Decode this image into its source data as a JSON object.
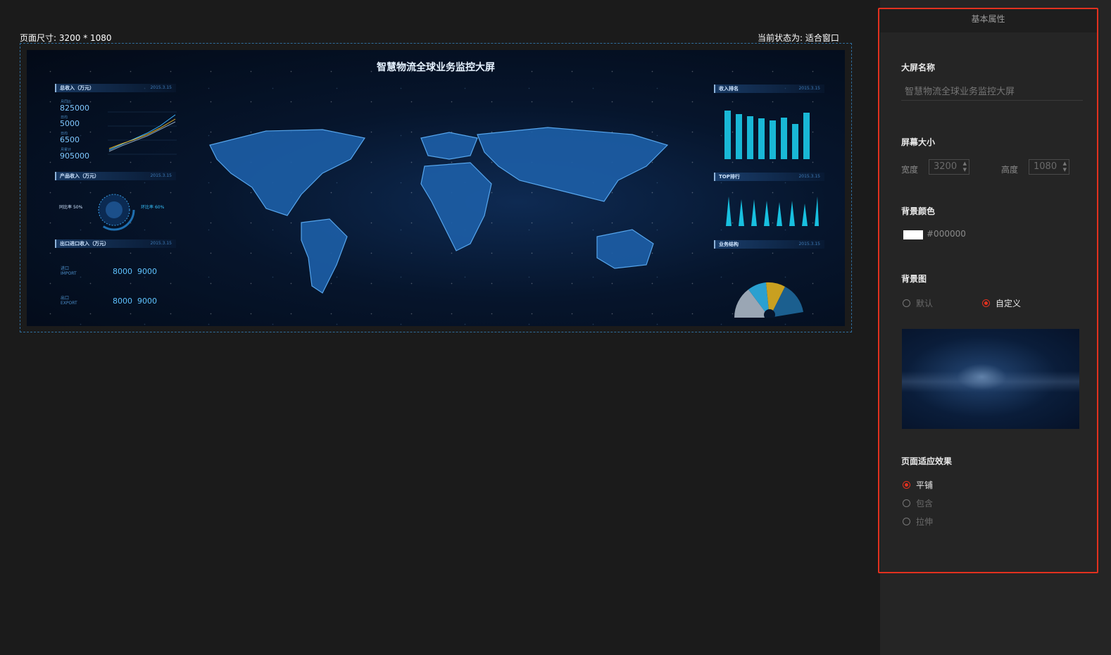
{
  "canvas": {
    "page_size_text": "页面尺寸: 3200 * 1080",
    "fit_state_text": "当前状态为: 适合窗口"
  },
  "preview": {
    "title": "智慧物流全球业务监控大屏",
    "panels": {
      "total_income": "总收入（万元）",
      "product_income": "产品收入（万元）",
      "import_export": "出口进口收入（万元）",
      "income_rank": "收入排名",
      "top_rank": "TOP排行",
      "business_structure": "业务结构"
    },
    "panel_date": "2015.3.15",
    "kpis": [
      {
        "label": "月同比",
        "value": "825000"
      },
      {
        "label": "日均",
        "value": "5000"
      },
      {
        "label": "日均",
        "value": "6500"
      },
      {
        "label": "月累计",
        "value": "905000"
      }
    ],
    "gauge": {
      "left_label": "同比率",
      "left_value": "50",
      "right_label": "环比率",
      "right_value": "60",
      "unit": "%"
    },
    "trade": [
      {
        "cn": "进口",
        "en": "IMPORT",
        "v1": "8000",
        "v2": "9000"
      },
      {
        "cn": "出口",
        "en": "EXPORT",
        "v1": "8000",
        "v2": "9000"
      }
    ]
  },
  "properties": {
    "header": "基本属性",
    "screen_name_label": "大屏名称",
    "screen_name_placeholder": "智慧物流全球业务监控大屏",
    "screen_size_label": "屏幕大小",
    "width_label": "宽度",
    "width_value": "3200",
    "height_label": "高度",
    "height_value": "1080",
    "bg_color_label": "背景颜色",
    "bg_color_value": "#000000",
    "bg_image_label": "背景图",
    "bg_option_default": "默认",
    "bg_option_custom": "自定义",
    "bg_selected": "custom",
    "fit_label": "页面适应效果",
    "fit_options": [
      "平铺",
      "包含",
      "拉伸"
    ],
    "fit_selected": "平铺"
  },
  "colors": {
    "accent_red": "#e2311f",
    "panel_bg": "#252525",
    "canvas_bg": "#1b1b1b"
  }
}
